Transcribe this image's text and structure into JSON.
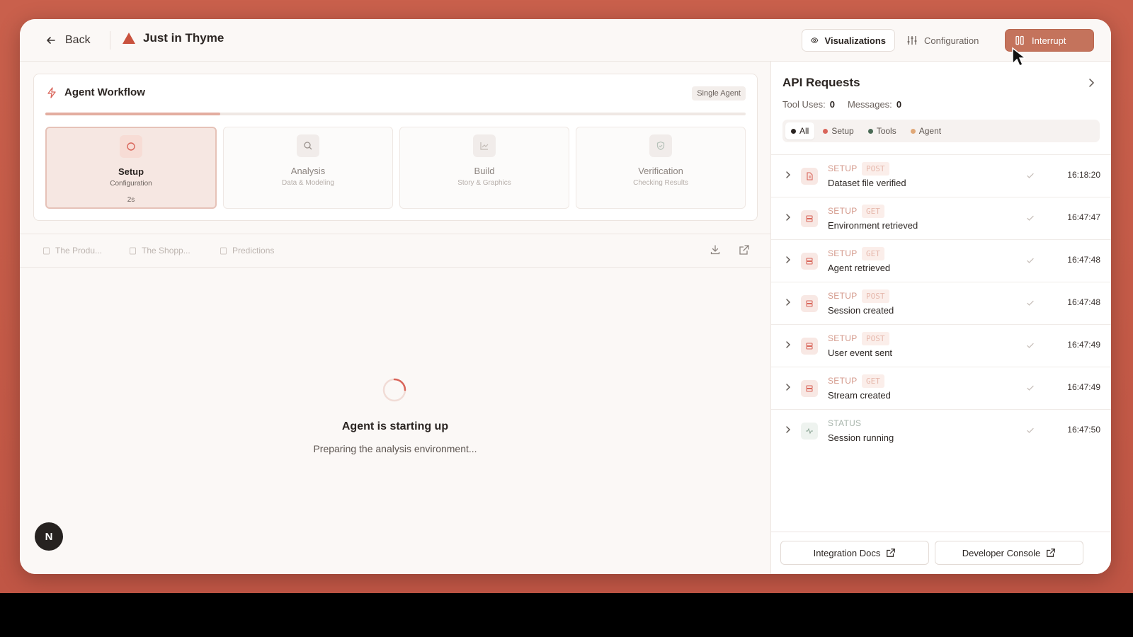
{
  "header": {
    "back_label": "Back",
    "app_title": "Just in Thyme",
    "visualizations_label": "Visualizations",
    "configuration_label": "Configuration",
    "interrupt_label": "Interrupt",
    "brand_color": "#c9523e"
  },
  "workflow": {
    "title": "Agent Workflow",
    "badge": "Single Agent",
    "progress": 0.25,
    "steps": [
      {
        "name": "Setup",
        "sub": "Configuration",
        "time": "2s",
        "active": true,
        "icon": "circle-icon"
      },
      {
        "name": "Analysis",
        "sub": "Data & Modeling",
        "icon": "search-icon"
      },
      {
        "name": "Build",
        "sub": "Story & Graphics",
        "icon": "chart-icon"
      },
      {
        "name": "Verification",
        "sub": "Checking Results",
        "icon": "shield-check-icon"
      }
    ]
  },
  "tabs": [
    {
      "label": "The Produ..."
    },
    {
      "label": "The Shopp..."
    },
    {
      "label": "Predictions"
    }
  ],
  "main": {
    "status_title": "Agent is starting up",
    "status_sub": "Preparing the analysis environment...",
    "avatar_letter": "N"
  },
  "api_panel": {
    "title": "API Requests",
    "tool_uses_label": "Tool Uses:",
    "tool_uses": "0",
    "messages_label": "Messages:",
    "messages": "0",
    "filters": [
      {
        "label": "All",
        "color": "#2b2522",
        "active": true
      },
      {
        "label": "Setup",
        "color": "#d9655a"
      },
      {
        "label": "Tools",
        "color": "#4a6a55"
      },
      {
        "label": "Agent",
        "color": "#e0a877"
      }
    ],
    "requests": [
      {
        "category": "SETUP",
        "method": "POST",
        "desc": "Dataset file verified",
        "time": "16:18:20",
        "icon": "file-icon"
      },
      {
        "category": "SETUP",
        "method": "GET",
        "desc": "Environment retrieved",
        "time": "16:47:47",
        "icon": "server-icon"
      },
      {
        "category": "SETUP",
        "method": "GET",
        "desc": "Agent retrieved",
        "time": "16:47:48",
        "icon": "server-icon"
      },
      {
        "category": "SETUP",
        "method": "POST",
        "desc": "Session created",
        "time": "16:47:48",
        "icon": "server-icon"
      },
      {
        "category": "SETUP",
        "method": "POST",
        "desc": "User event sent",
        "time": "16:47:49",
        "icon": "server-icon"
      },
      {
        "category": "SETUP",
        "method": "GET",
        "desc": "Stream created",
        "time": "16:47:49",
        "icon": "server-icon"
      },
      {
        "category": "STATUS",
        "method": "",
        "desc": "Session running",
        "time": "16:47:50",
        "icon": "activity-icon"
      }
    ],
    "integration_docs_label": "Integration Docs",
    "developer_console_label": "Developer Console"
  }
}
